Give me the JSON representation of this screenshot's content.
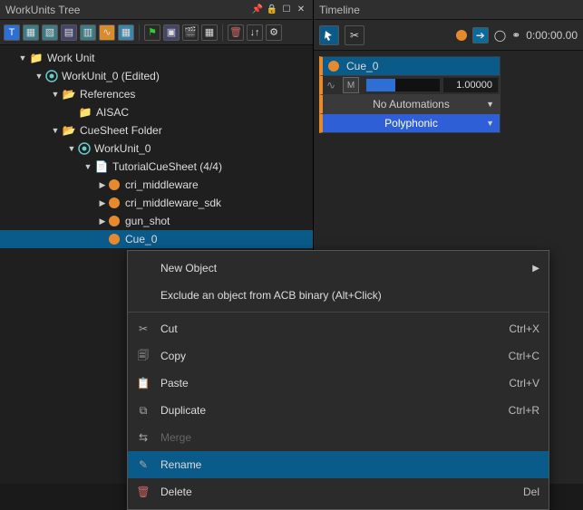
{
  "panels": {
    "left_title": "WorkUnits Tree",
    "right_title": "Timeline"
  },
  "tree": {
    "root": "Work Unit",
    "wu0": "WorkUnit_0 (Edited)",
    "refs": "References",
    "aisac": "AISAC",
    "csfolder": "CueSheet Folder",
    "wu0b": "WorkUnit_0",
    "sheet": "TutorialCueSheet (4/4)",
    "cue1": "cri_middleware",
    "cue2": "cri_middleware_sdk",
    "cue3": "gun_shot",
    "cue4": "Cue_0"
  },
  "timeline": {
    "time": "0:00:00.00"
  },
  "inspector": {
    "cue_name": "Cue_0",
    "m_label": "M",
    "value": "1.00000",
    "automation": "No Automations",
    "type": "Polyphonic"
  },
  "context_menu": {
    "new_object": "New Object",
    "exclude": "Exclude an object from ACB binary (Alt+Click)",
    "cut": "Cut",
    "cut_sc": "Ctrl+X",
    "copy": "Copy",
    "copy_sc": "Ctrl+C",
    "paste": "Paste",
    "paste_sc": "Ctrl+V",
    "duplicate": "Duplicate",
    "duplicate_sc": "Ctrl+R",
    "merge": "Merge",
    "rename": "Rename",
    "delete": "Delete",
    "delete_sc": "Del"
  }
}
